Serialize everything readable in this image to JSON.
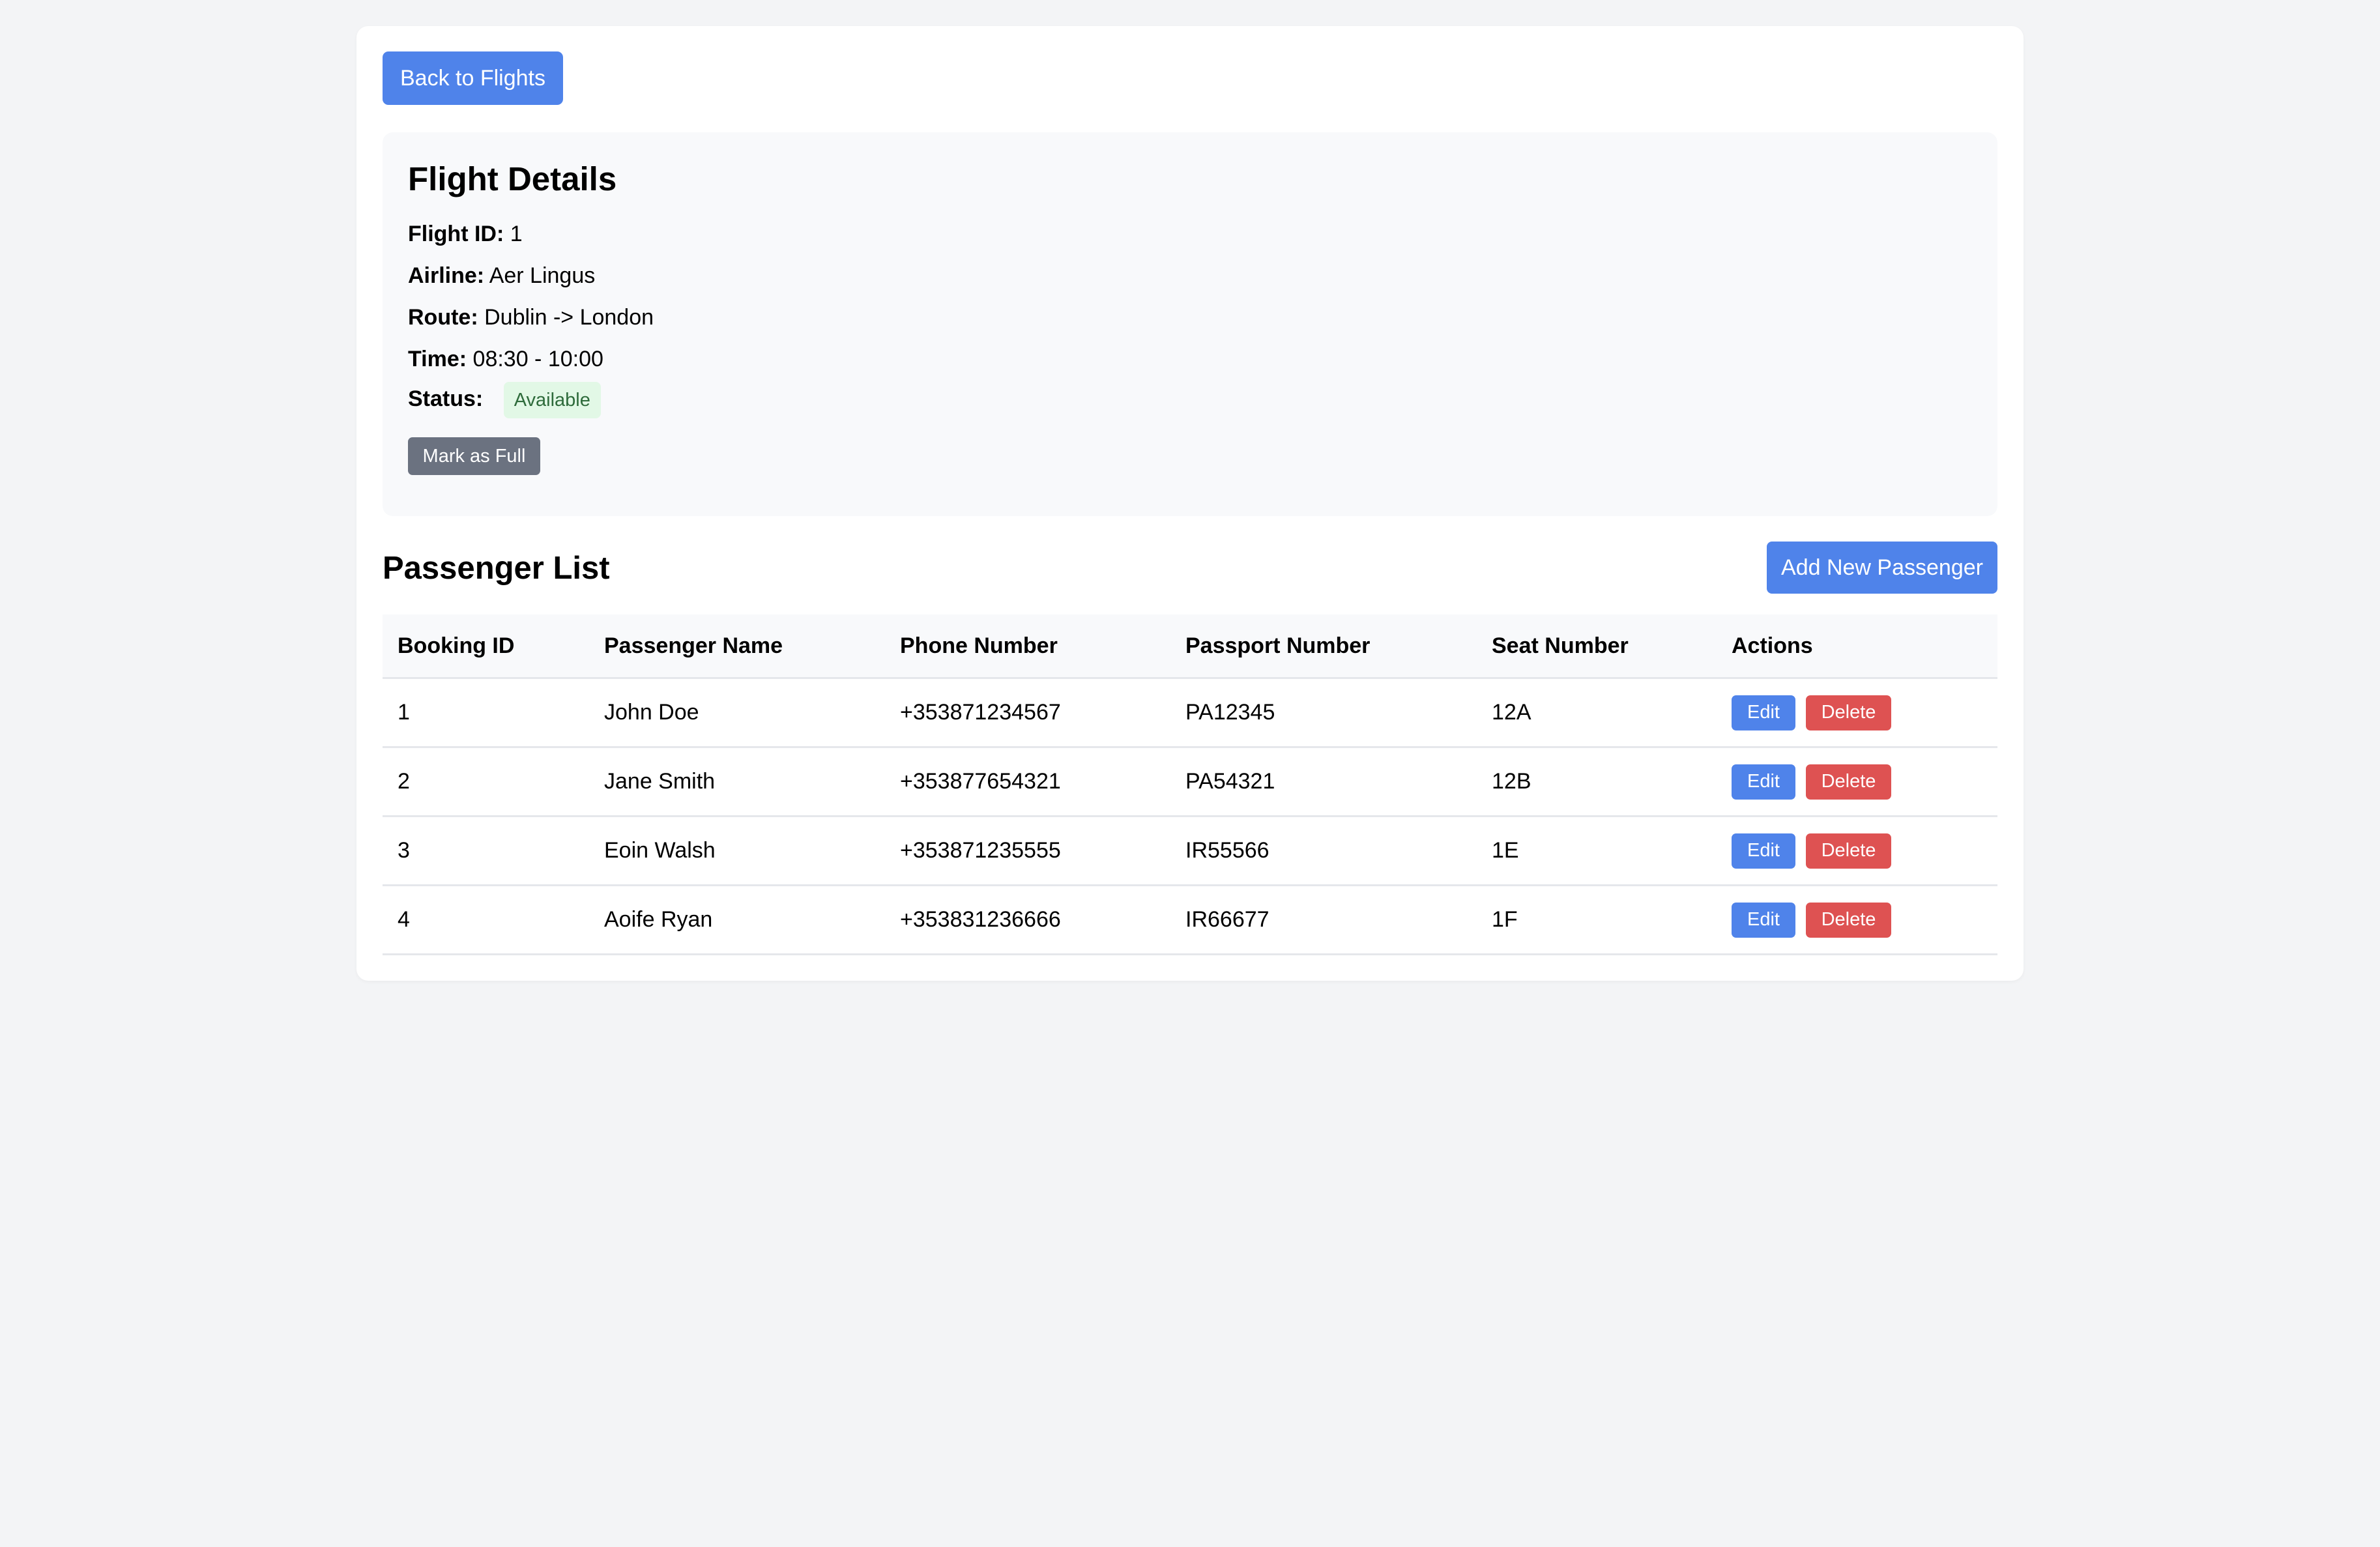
{
  "navigation": {
    "back_label": "Back to Flights"
  },
  "flight_details": {
    "title": "Flight Details",
    "fields": [
      {
        "label": "Flight ID:",
        "value": "1"
      },
      {
        "label": "Airline:",
        "value": "Aer Lingus"
      },
      {
        "label": "Route:",
        "value": "Dublin -> London"
      },
      {
        "label": "Time:",
        "value": "08:30 - 10:00"
      }
    ],
    "status_label": "Status:",
    "status_value": "Available",
    "mark_full_label": "Mark as Full"
  },
  "passengers": {
    "title": "Passenger List",
    "add_label": "Add New Passenger",
    "columns": [
      "Booking ID",
      "Passenger Name",
      "Phone Number",
      "Passport Number",
      "Seat Number",
      "Actions"
    ],
    "rows": [
      {
        "booking_id": "1",
        "name": "John Doe",
        "phone": "+353871234567",
        "passport": "PA12345",
        "seat": "12A"
      },
      {
        "booking_id": "2",
        "name": "Jane Smith",
        "phone": "+353877654321",
        "passport": "PA54321",
        "seat": "12B"
      },
      {
        "booking_id": "3",
        "name": "Eoin Walsh",
        "phone": "+353871235555",
        "passport": "IR55566",
        "seat": "1E"
      },
      {
        "booking_id": "4",
        "name": "Aoife Ryan",
        "phone": "+353831236666",
        "passport": "IR66677",
        "seat": "1F"
      }
    ],
    "edit_label": "Edit",
    "delete_label": "Delete"
  },
  "colors": {
    "primary": "#4f83ea",
    "danger": "#de5252",
    "secondary": "#6b7280",
    "status_available_bg": "#e2f8e6",
    "status_available_text": "#2e6b3b"
  }
}
